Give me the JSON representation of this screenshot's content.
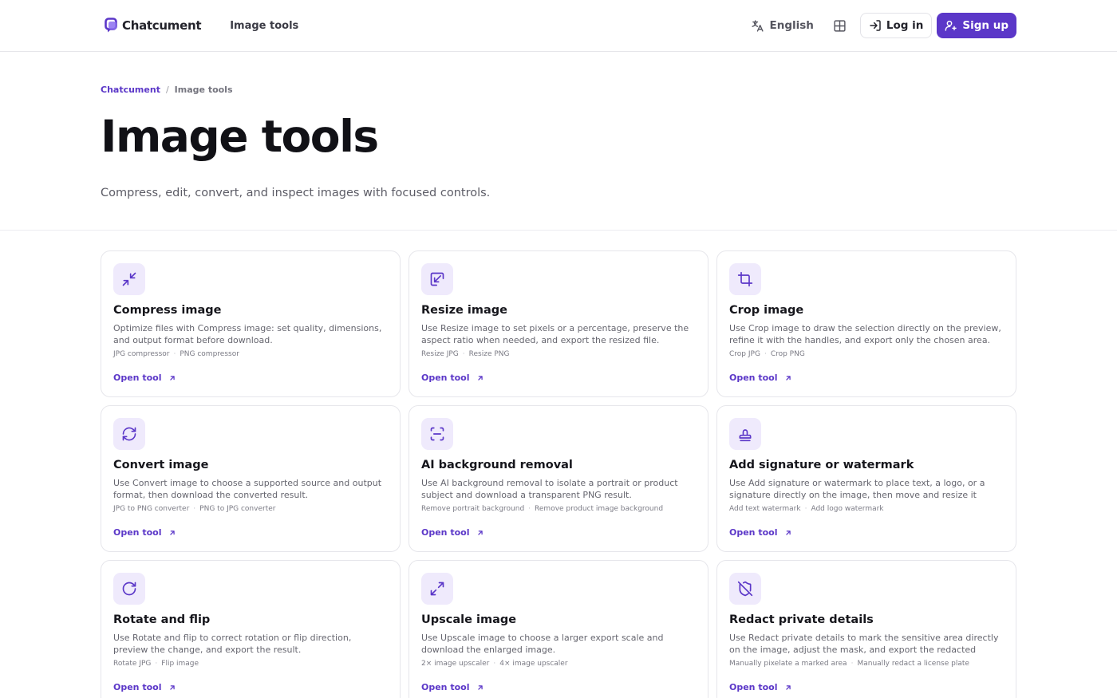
{
  "header": {
    "brand": "Chatcument",
    "nav_link": "Image tools",
    "language": "English",
    "login_label": "Log in",
    "signup_label": "Sign up"
  },
  "colors": {
    "accent": "#5b37c8",
    "icon_bg": "#efeafc"
  },
  "breadcrumb": {
    "root": "Chatcument",
    "separator": "/",
    "current": "Image tools"
  },
  "hero": {
    "title": "Image tools",
    "subtitle": "Compress, edit, convert, and inspect images with focused controls."
  },
  "cards": [
    {
      "icon": "compress-icon",
      "title": "Compress image",
      "description": "Optimize files with Compress image: set quality, dimensions, and output format before download.",
      "tags": [
        "JPG compressor",
        "PNG compressor"
      ],
      "link": "Open tool"
    },
    {
      "icon": "resize-icon",
      "title": "Resize image",
      "description": "Use Resize image to set pixels or a percentage, preserve the aspect ratio when needed, and export the resized file.",
      "tags": [
        "Resize JPG",
        "Resize PNG"
      ],
      "link": "Open tool"
    },
    {
      "icon": "crop-icon",
      "title": "Crop image",
      "description": "Use Crop image to draw the selection directly on the preview, refine it with the handles, and export only the chosen area.",
      "tags": [
        "Crop JPG",
        "Crop PNG"
      ],
      "link": "Open tool"
    },
    {
      "icon": "convert-icon",
      "title": "Convert image",
      "description": "Use Convert image to choose a supported source and output format, then download the converted result.",
      "tags": [
        "JPG to PNG converter",
        "PNG to JPG converter"
      ],
      "link": "Open tool"
    },
    {
      "icon": "scan-icon",
      "title": "AI background removal",
      "description": "Use AI background removal to isolate a portrait or product subject and download a transparent PNG result.",
      "tags": [
        "Remove portrait background",
        "Remove product image background"
      ],
      "link": "Open tool"
    },
    {
      "icon": "stamp-icon",
      "title": "Add signature or watermark",
      "description": "Use Add signature or watermark to place text, a logo, or a signature directly on the image, then move and resize it befor...",
      "tags": [
        "Add text watermark",
        "Add logo watermark"
      ],
      "link": "Open tool"
    },
    {
      "icon": "rotate-icon",
      "title": "Rotate and flip",
      "description": "Use Rotate and flip to correct rotation or flip direction, preview the change, and export the result.",
      "tags": [
        "Rotate JPG",
        "Flip image"
      ],
      "link": "Open tool"
    },
    {
      "icon": "upscale-icon",
      "title": "Upscale image",
      "description": "Use Upscale image to choose a larger export scale and download the enlarged image.",
      "tags": [
        "2× image upscaler",
        "4× image upscaler"
      ],
      "link": "Open tool"
    },
    {
      "icon": "shield-off-icon",
      "title": "Redact private details",
      "description": "Use Redact private details to mark the sensitive area directly on the image, adjust the mask, and export the redacted result.",
      "tags": [
        "Manually pixelate a marked area",
        "Manually redact a license plate"
      ],
      "link": "Open tool"
    }
  ]
}
